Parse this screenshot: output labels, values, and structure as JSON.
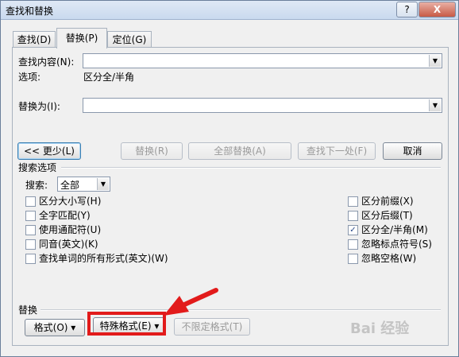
{
  "window": {
    "title": "查找和替换",
    "help_label": "?",
    "close_label": "X"
  },
  "tabs": [
    {
      "label": "查找(D)",
      "active": false
    },
    {
      "label": "替换(P)",
      "active": true
    },
    {
      "label": "定位(G)",
      "active": false
    }
  ],
  "find": {
    "label": "查找内容(N):",
    "value": "",
    "options_label": "选项:",
    "options_value": "区分全/半角"
  },
  "replace": {
    "label": "替换为(I):",
    "value": ""
  },
  "buttons": {
    "less": "<< 更少(L)",
    "replace": "替换(R)",
    "replace_all": "全部替换(A)",
    "find_next": "查找下一处(F)",
    "cancel": "取消"
  },
  "search_options": {
    "heading": "搜索选项",
    "search_label": "搜索:",
    "search_value": "全部",
    "left": [
      {
        "label": "区分大小写(H)",
        "checked": false
      },
      {
        "label": "全字匹配(Y)",
        "checked": false
      },
      {
        "label": "使用通配符(U)",
        "checked": false
      },
      {
        "label": "同音(英文)(K)",
        "checked": false
      },
      {
        "label": "查找单词的所有形式(英文)(W)",
        "checked": false
      }
    ],
    "right": [
      {
        "label": "区分前缀(X)",
        "checked": false
      },
      {
        "label": "区分后缀(T)",
        "checked": false
      },
      {
        "label": "区分全/半角(M)",
        "checked": true
      },
      {
        "label": "忽略标点符号(S)",
        "checked": false
      },
      {
        "label": "忽略空格(W)",
        "checked": false
      }
    ]
  },
  "replace_section": {
    "heading": "替换",
    "format": "格式(O)",
    "special": "特殊格式(E)",
    "no_format": "不限定格式(T)"
  },
  "watermark": "Bai 经验",
  "colors": {
    "highlight": "#e21b1b",
    "close_button": "#c75a45"
  }
}
